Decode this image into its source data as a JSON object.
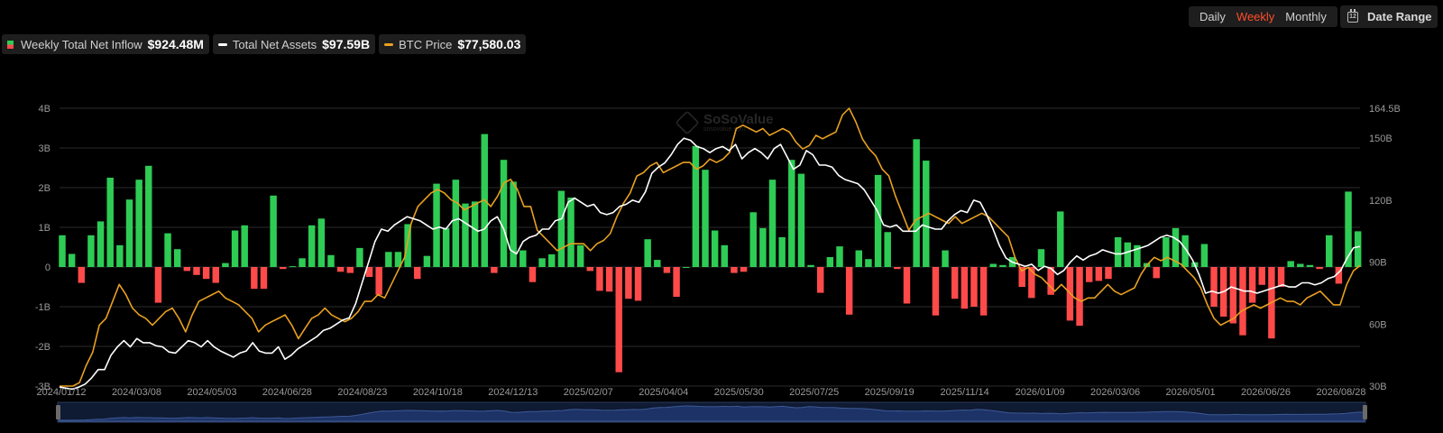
{
  "legend": {
    "inflow_label": "Weekly Total Net Inflow",
    "inflow_value": "$924.48M",
    "assets_label": "Total Net Assets",
    "assets_value": "$97.59B",
    "btc_label": "BTC Price",
    "btc_value": "$77,580.03"
  },
  "tabs": [
    "Daily",
    "Weekly",
    "Monthly"
  ],
  "active_tab": "Weekly",
  "date_range_label": "Date Range",
  "watermark": {
    "name": "SoSoValue",
    "sub": "sosovalue.com"
  },
  "colors": {
    "positive": "#2ecc55",
    "negative": "#ff4a4a",
    "assets_line": "#ffffff",
    "btc_line": "#e8a020",
    "active_tab": "#ff4d2a"
  },
  "chart_data": {
    "type": "bar",
    "x_ticks": [
      "2024/01/12",
      "2024/03/08",
      "2024/05/03",
      "2024/06/28",
      "2024/08/23",
      "2024/10/18",
      "2024/12/13",
      "2025/02/07",
      "2025/04/04",
      "2025/05/30",
      "2025/07/25",
      "2025/09/19",
      "2025/11/14",
      "2026/01/09",
      "2026/03/06",
      "2026/05/01",
      "2026/06/26",
      "2026/08/28"
    ],
    "y_left_ticks": [
      "4B",
      "3B",
      "2B",
      "1B",
      "0",
      "-1B",
      "-2B",
      "-3B"
    ],
    "y_left_range": [
      -3,
      4
    ],
    "y_right_ticks": [
      "164.5B",
      "150B",
      "120B",
      "90B",
      "60B",
      "30B"
    ],
    "y_right_range": [
      30,
      164.5
    ],
    "grid": true,
    "legend_position": "top-left",
    "series": [
      {
        "name": "Weekly Total Net Inflow",
        "unit": "B USD",
        "values": [
          0.8,
          0.33,
          -0.4,
          0.8,
          1.15,
          2.25,
          0.55,
          1.7,
          2.2,
          2.55,
          -0.9,
          0.85,
          0.45,
          -0.1,
          -0.2,
          -0.3,
          -0.4,
          0.1,
          0.92,
          1.05,
          -0.55,
          -0.55,
          1.8,
          -0.05,
          0.02,
          0.22,
          1.05,
          1.22,
          0.3,
          -0.12,
          -0.15,
          0.48,
          -0.25,
          -0.7,
          0.38,
          0.38,
          1.08,
          -0.3,
          0.28,
          2.1,
          0.98,
          2.2,
          1.6,
          1.65,
          3.35,
          -0.15,
          2.7,
          2.15,
          0.42,
          -0.38,
          0.22,
          0.32,
          1.92,
          1.75,
          0.55,
          -0.1,
          -0.6,
          -0.62,
          -2.65,
          -0.8,
          -0.85,
          0.7,
          0.18,
          -0.15,
          -0.75,
          0.0,
          3.05,
          2.45,
          0.92,
          0.55,
          -0.15,
          -0.12,
          1.38,
          0.98,
          2.2,
          0.75,
          2.7,
          2.35,
          0.05,
          -0.65,
          0.25,
          0.52,
          -1.2,
          0.42,
          0.2,
          2.32,
          0.88,
          -0.05,
          -0.92,
          3.22,
          2.68,
          -1.22,
          0.42,
          -0.8,
          -1.05,
          -1.0,
          -1.22,
          0.08,
          0.05,
          0.25,
          -0.5,
          -0.78,
          0.45,
          -0.7,
          1.4,
          -1.35,
          -1.48,
          -0.38,
          -0.35,
          -0.3,
          0.75,
          0.62,
          0.55,
          0.1,
          -0.28,
          0.75,
          0.98,
          0.8,
          0.12,
          0.58,
          -1.0,
          -1.25,
          -1.42,
          -1.72,
          -0.9,
          -0.45,
          -1.8,
          -0.5,
          0.15,
          0.08,
          0.05,
          -0.05,
          0.8,
          -0.42,
          1.9,
          0.9
        ]
      },
      {
        "name": "Total Net Assets",
        "unit": "B USD",
        "values": [
          29.5,
          29,
          28.5,
          29.5,
          31,
          34,
          38,
          38,
          45,
          49,
          52,
          49,
          53,
          51,
          51,
          49.5,
          49,
          46.5,
          46,
          49,
          52,
          51,
          49,
          52,
          49,
          47,
          45.5,
          44,
          46,
          47,
          51,
          47,
          46,
          46,
          49,
          43,
          45,
          48,
          50,
          52,
          54,
          57,
          58,
          60,
          62,
          63,
          70,
          80,
          90,
          100,
          106,
          105,
          108,
          110,
          112,
          111,
          110,
          108,
          106,
          107,
          106,
          110,
          111,
          109,
          107,
          105,
          106,
          110,
          112,
          106,
          96,
          94,
          100,
          102,
          103,
          106,
          106,
          110,
          111,
          119,
          121,
          119,
          117,
          118,
          114,
          113,
          114,
          117,
          118,
          120,
          119,
          124,
          133,
          136,
          138,
          142,
          147,
          150,
          149,
          146,
          145,
          143,
          145,
          146,
          144,
          147,
          140,
          143,
          145,
          143,
          140,
          145,
          147,
          141,
          135,
          137,
          144,
          142,
          137,
          137,
          136,
          132,
          130,
          129,
          128,
          125,
          120,
          115,
          108,
          107,
          108,
          105,
          105,
          105,
          108,
          107,
          106,
          106,
          110,
          113,
          115,
          114,
          120,
          119,
          113,
          106,
          98,
          92,
          90,
          89,
          88,
          89,
          86,
          88,
          87,
          84,
          86,
          90,
          93,
          91,
          93,
          94,
          96,
          95,
          94,
          94,
          95,
          96,
          97,
          98,
          100,
          102,
          103,
          102,
          100,
          96,
          91,
          84,
          75,
          76,
          75,
          76,
          78,
          77,
          76,
          76,
          75,
          76,
          77,
          78,
          79,
          78,
          78,
          80,
          80,
          79,
          80,
          82,
          83,
          86,
          92,
          97,
          97.59
        ]
      },
      {
        "name": "BTC Price",
        "unit": "USD",
        "values": [
          42000,
          42000,
          42000,
          43000,
          48000,
          52000,
          60000,
          62000,
          67000,
          72000,
          69000,
          65000,
          63000,
          62000,
          60000,
          62000,
          64000,
          65000,
          62000,
          58000,
          63000,
          67000,
          68000,
          69000,
          70000,
          68000,
          67000,
          66000,
          64000,
          62000,
          58000,
          60000,
          61000,
          62000,
          63000,
          60000,
          56000,
          59000,
          62000,
          63000,
          65000,
          63000,
          62000,
          61000,
          62000,
          64000,
          67000,
          67000,
          69000,
          68000,
          72000,
          76000,
          80000,
          90000,
          95000,
          97000,
          99000,
          100000,
          99000,
          97000,
          96000,
          94000,
          95000,
          96000,
          97000,
          95000,
          98000,
          102000,
          103000,
          100000,
          95000,
          95000,
          88000,
          86000,
          84000,
          82000,
          83000,
          84000,
          84000,
          84000,
          82000,
          84000,
          85000,
          87000,
          92000,
          96000,
          99000,
          104000,
          105000,
          107000,
          108000,
          105000,
          106000,
          107000,
          108000,
          108000,
          106000,
          107000,
          109000,
          108000,
          109000,
          111000,
          118000,
          119000,
          118000,
          117000,
          118000,
          116000,
          117000,
          118000,
          117000,
          114000,
          112000,
          113000,
          116000,
          115000,
          116000,
          117000,
          122000,
          124000,
          120000,
          115000,
          112000,
          110000,
          106000,
          104000,
          98000,
          93000,
          88000,
          91000,
          92000,
          93000,
          92000,
          91000,
          90000,
          92000,
          90000,
          91000,
          92000,
          93000,
          92000,
          90000,
          88000,
          86000,
          80000,
          76000,
          77000,
          75000,
          74000,
          72000,
          70000,
          72000,
          70000,
          68000,
          67000,
          68000,
          68000,
          70000,
          72000,
          70000,
          69000,
          70000,
          71000,
          75000,
          78000,
          80000,
          79000,
          80000,
          79000,
          78000,
          76000,
          74000,
          71000,
          66000,
          62000,
          60000,
          61000,
          62000,
          64000,
          65000,
          66000,
          65000,
          66000,
          67000,
          68000,
          67000,
          67000,
          66000,
          68000,
          69000,
          70000,
          68000,
          66000,
          66000,
          72000,
          76000,
          77580.03
        ]
      }
    ]
  }
}
